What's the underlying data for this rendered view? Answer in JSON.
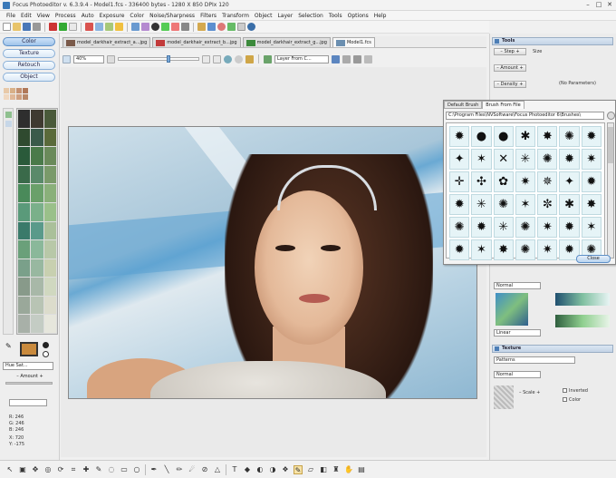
{
  "window": {
    "title": "Focus Photoeditor v. 6.3.9.4 - Model1.fcs - 336400 bytes - 1280 X 850 DPIx 120",
    "minimize": "–",
    "maximize": "□",
    "close": "✕"
  },
  "menu": [
    "File",
    "Edit",
    "View",
    "Process",
    "Auto",
    "Exposure",
    "Color",
    "Noise/Sharpness",
    "Filters",
    "Transform",
    "Object",
    "Layer",
    "Selection",
    "Tools",
    "Options",
    "Help"
  ],
  "left_panel": {
    "buttons": [
      "Color",
      "Texture",
      "Retouch",
      "Object"
    ],
    "blend_select": "Hue Sat...",
    "amount_label": "– Amount +",
    "readout": [
      "R: 246",
      "G: 246",
      "B: 246",
      "X: 720",
      "Y: -175"
    ]
  },
  "tabs": [
    "model_darkhair_extract_a...jpg",
    "model_darkhair_extract_b...jpg",
    "model_darkhair_extract_g...jpg",
    "Model1.fcs"
  ],
  "image_toolbar": {
    "zoom": "40%",
    "layer_select": "Layer From C..."
  },
  "brush_popup": {
    "tabs": [
      "Default Brush",
      "Brush From File"
    ],
    "path": "C:\\Program Files\\NVSoftware\\Focus Photoeditor 6\\Brushes\\",
    "close_label": "Close",
    "brush_glyphs": [
      "✹",
      "●",
      "●",
      "✱",
      "✸",
      "✺",
      "✹",
      "✦",
      "✶",
      "✕",
      "✳",
      "✺",
      "✹",
      "✷",
      "✛",
      "✣",
      "✿",
      "✷",
      "✵",
      "✦",
      "✹",
      "✹",
      "✳",
      "✺",
      "✶",
      "✼",
      "✱",
      "✸",
      "✺",
      "✹",
      "✳",
      "✺",
      "✷",
      "✹",
      "✶",
      "✹",
      "✶",
      "✸",
      "✺",
      "✷",
      "✹",
      "✺"
    ]
  },
  "right_panel": {
    "tools_header": "Tools",
    "step_label": "– Step +",
    "amount_label": "– Amount +",
    "density_label": "– Density +",
    "size_label": "Size",
    "no_params": "(No Parameters)",
    "blend_mode": "Normal",
    "gradient_type": "Linear",
    "texture_header": "Texture",
    "patterns_select": "Patterns",
    "texture_blend": "Normal",
    "scale_label": "– Scale +",
    "inverted_label": "Inverted",
    "color_label": "Color"
  },
  "colors": {
    "accent": "#5d8fc7",
    "panel_bg": "#ececec"
  }
}
